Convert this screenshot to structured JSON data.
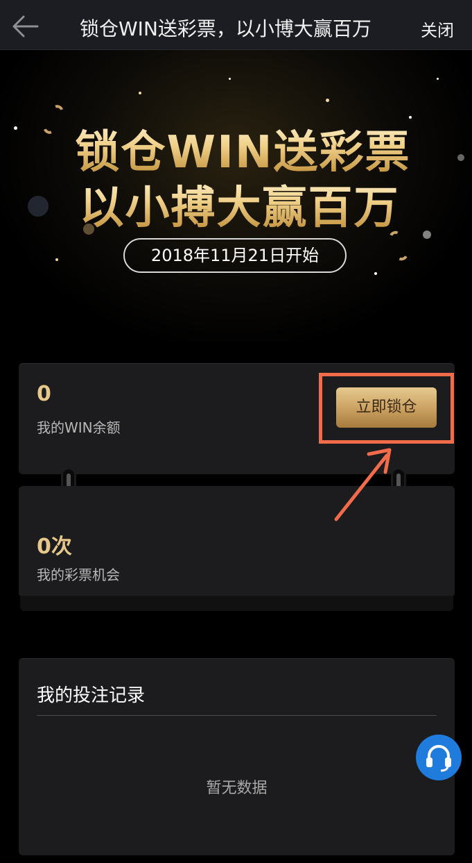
{
  "navbar": {
    "title": "锁仓WIN送彩票，以小博大赢百万",
    "close_label": "关闭"
  },
  "hero": {
    "line1": "锁仓WIN送彩票",
    "line2": "以小搏大赢百万",
    "date": "2018年11月21日开始"
  },
  "balance": {
    "value": "0",
    "label": "我的WIN余额",
    "lock_button": "立即锁仓"
  },
  "lottery": {
    "value": "0次",
    "label": "我的彩票机会"
  },
  "records": {
    "title": "我的投注记录",
    "empty_text": "暂无数据"
  },
  "colors": {
    "accent_gold": "#e8c88a",
    "highlight": "#f26c4b",
    "support_blue": "#1f7cdd"
  }
}
